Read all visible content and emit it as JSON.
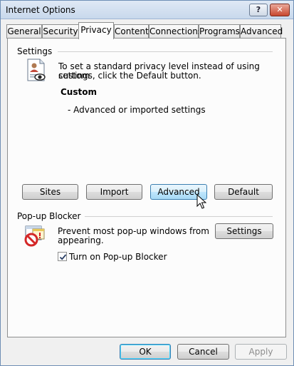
{
  "window": {
    "title": "Internet Options",
    "help_label": "?",
    "close_label": "✕"
  },
  "tabs": [
    {
      "label": "General"
    },
    {
      "label": "Security"
    },
    {
      "label": "Privacy"
    },
    {
      "label": "Content"
    },
    {
      "label": "Connections"
    },
    {
      "label": "Programs"
    },
    {
      "label": "Advanced"
    }
  ],
  "settings": {
    "group_label": "Settings",
    "description_line1": "To set a standard privacy level instead of using custom",
    "description_line2": "settings, click the Default button.",
    "level_title": "Custom",
    "level_detail": "- Advanced or imported settings",
    "buttons": {
      "sites": "Sites",
      "import": "Import",
      "advanced": "Advanced",
      "default": "Default"
    }
  },
  "popup": {
    "group_label": "Pop-up Blocker",
    "description_line1": "Prevent most pop-up windows from",
    "description_line2": "appearing.",
    "settings_button": "Settings",
    "checkbox_label": "Turn on Pop-up Blocker",
    "checkbox_checked": true
  },
  "footer": {
    "ok": "OK",
    "cancel": "Cancel",
    "apply": "Apply"
  }
}
